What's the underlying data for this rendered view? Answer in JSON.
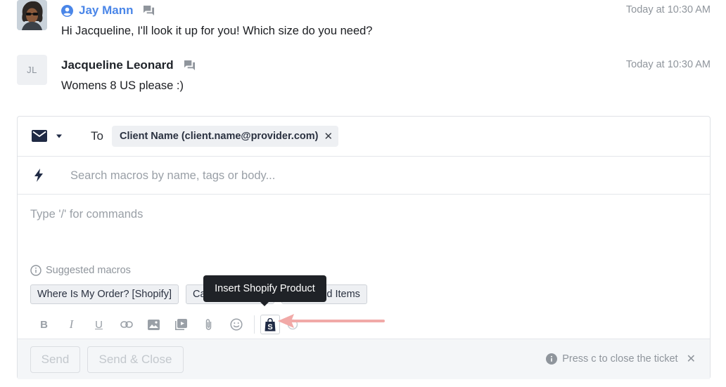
{
  "messages": [
    {
      "author": "Jay Mann",
      "time": "Today at 10:30 AM",
      "body": "Hi Jacqueline, I'll look it up for you! Which size do you need?"
    },
    {
      "avatar_initials": "JL",
      "author": "Jacqueline Leonard",
      "time": "Today at 10:30 AM",
      "body": "Womens 8 US please :)"
    }
  ],
  "composer": {
    "to_label": "To",
    "recipient": "Client Name (client.name@provider.com)",
    "macro_search_placeholder": "Search macros by name, tags or body...",
    "body_placeholder": "Type '/' for commands",
    "suggested_label": "Suggested macros",
    "suggested_macros": [
      "Where Is My Order? [Shopify]",
      "Cancel [Shopify]",
      "Damaged Items"
    ],
    "toolbar": {
      "bold": "B",
      "italic": "I",
      "underline": "U"
    },
    "tooltip": "Insert Shopify Product",
    "send_label": "Send",
    "send_close_label": "Send & Close",
    "hint": "Press c to close the ticket"
  },
  "colors": {
    "agent_name": "#4a86e8",
    "annotation_arrow": "#f1a9a7",
    "tooltip_bg": "#1f2227"
  }
}
